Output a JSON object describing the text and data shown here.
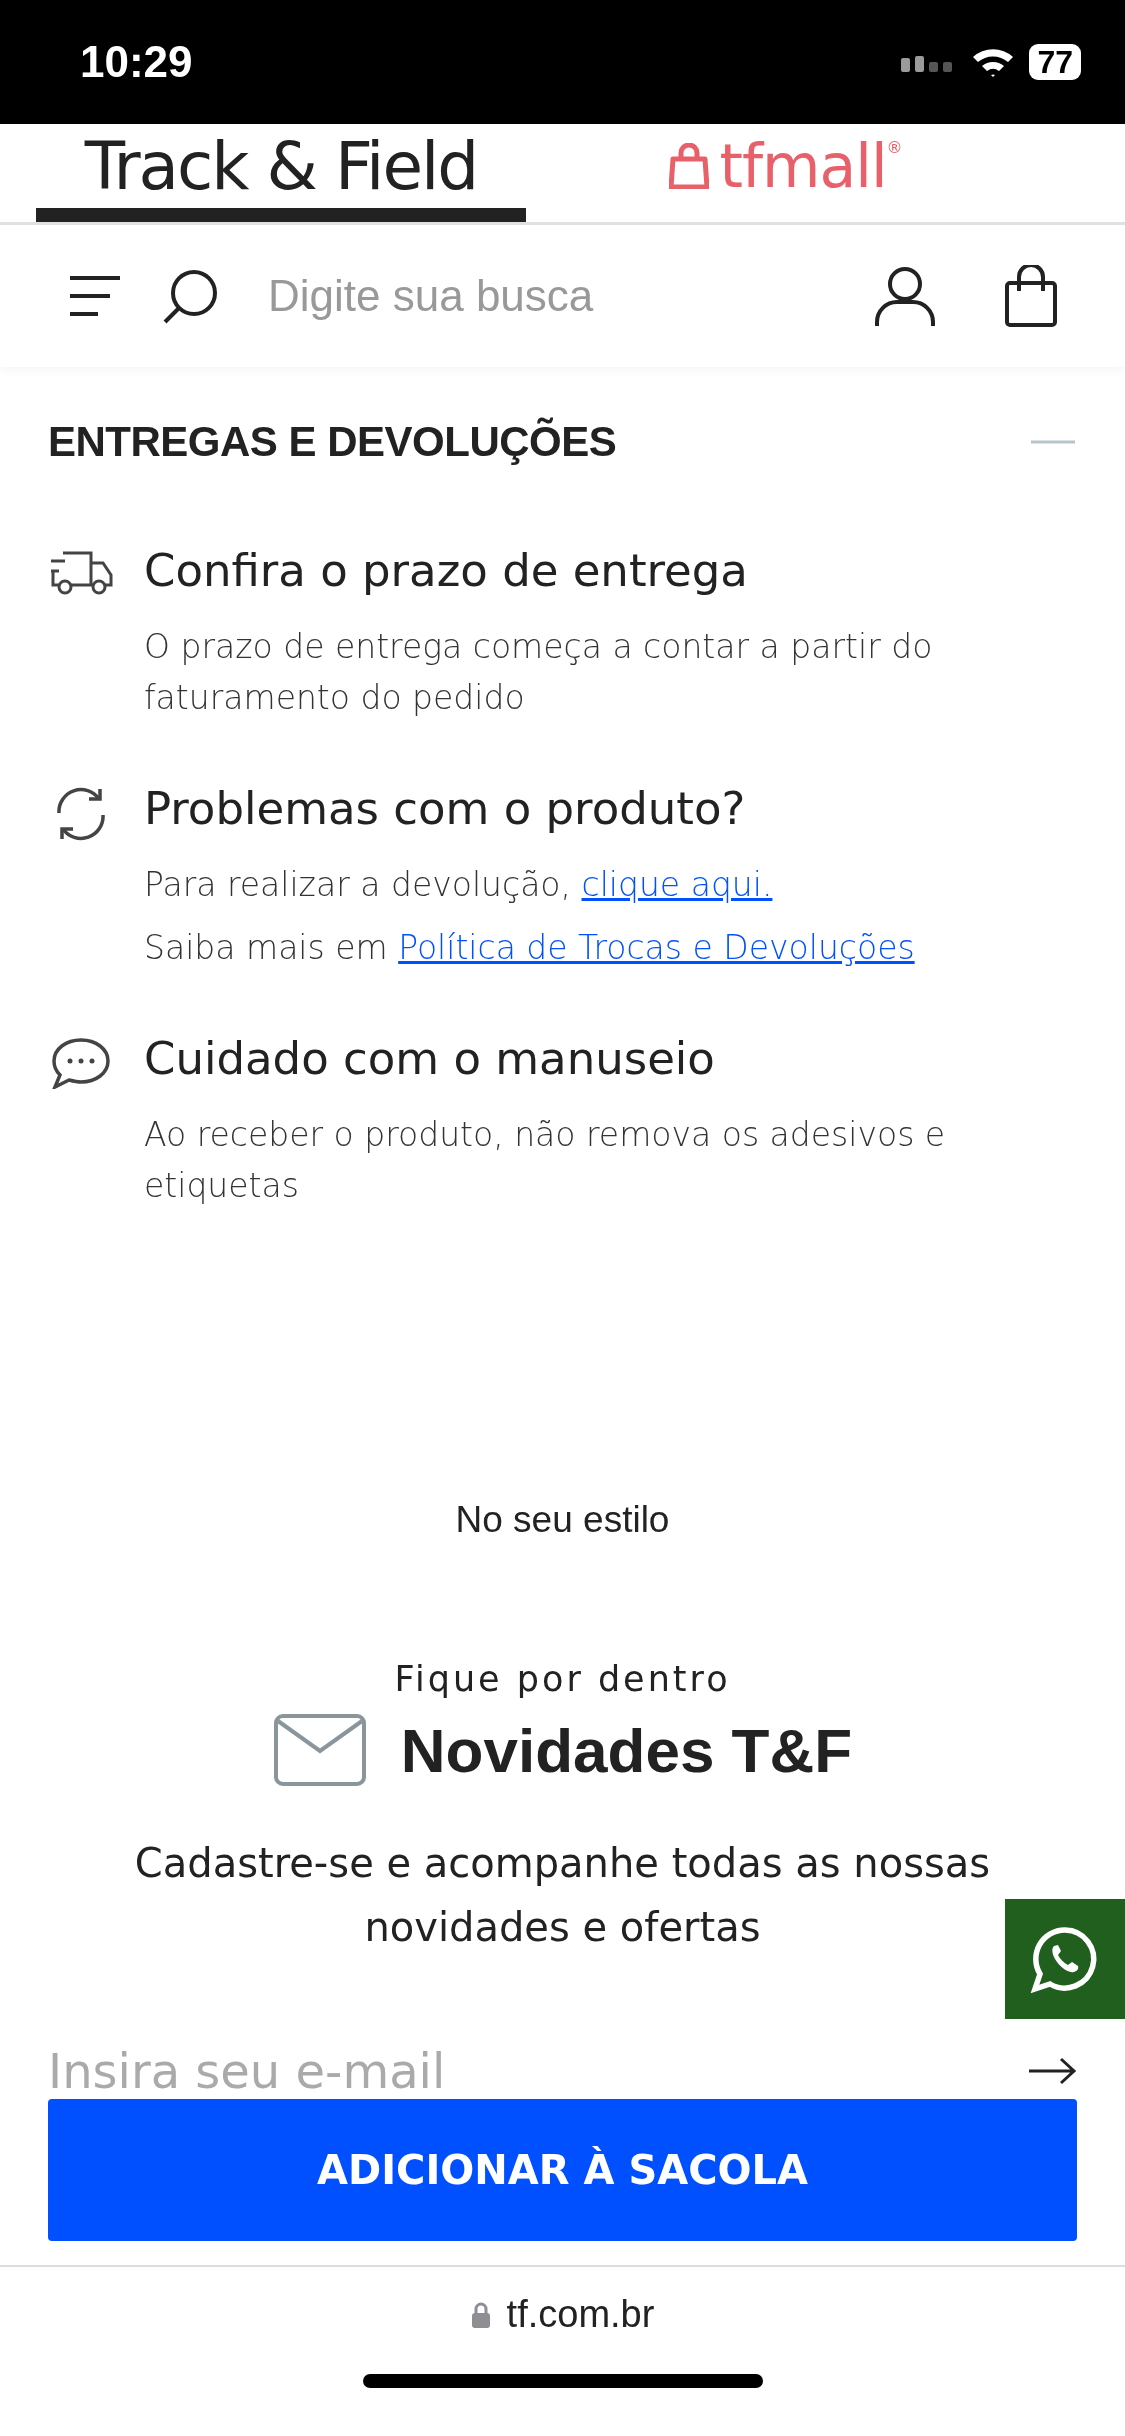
{
  "status_bar": {
    "time": "10:29",
    "battery": "77"
  },
  "brand_tabs": [
    {
      "kind": "wordmark",
      "label": "Track & Field",
      "selected": true
    },
    {
      "kind": "bag-wordmark",
      "label": "tfmall$^{®}$",
      "selected": false
    }
  ],
  "header": {
    "search": {
      "placeholder": "Digite sua busca"
    }
  },
  "section": {
    "title": "ENTREGAS E DEVOLUÇÕES",
    "expanded": true,
    "items": [
      {
        "kind": "truck",
        "title": "Confira o prazo de entrega",
        "lines": [
          {
            "text": "O prazo de entrega começa a contar a partir do faturamento do pedido"
          }
        ]
      },
      {
        "kind": "refresh",
        "title": "Problemas com o produto?",
        "lines": [
          {
            "text": "Para realizar a devolução,",
            "link": "clique aqui."
          },
          {
            "text": "Saiba mais em",
            "link": "Política de Trocas e Devoluções"
          }
        ]
      },
      {
        "kind": "chat",
        "title": "Cuidado com o manuseio",
        "lines": [
          {
            "text": "Ao receber o produto, não remova os adesivos e etiquetas"
          }
        ]
      }
    ]
  },
  "recommendations": {
    "title": "No seu estilo"
  },
  "newsletter": {
    "eyebrow": "Fique por dentro",
    "title": "Novidades T&F",
    "description": "Cadastre-se e acompanhe todas as nossas novidades e ofertas",
    "email": {
      "placeholder": "Insira seu e-mail"
    }
  },
  "cta": {
    "label": "ADICIONAR À SACOLA"
  },
  "browser": {
    "url": "tf.com.br"
  }
}
